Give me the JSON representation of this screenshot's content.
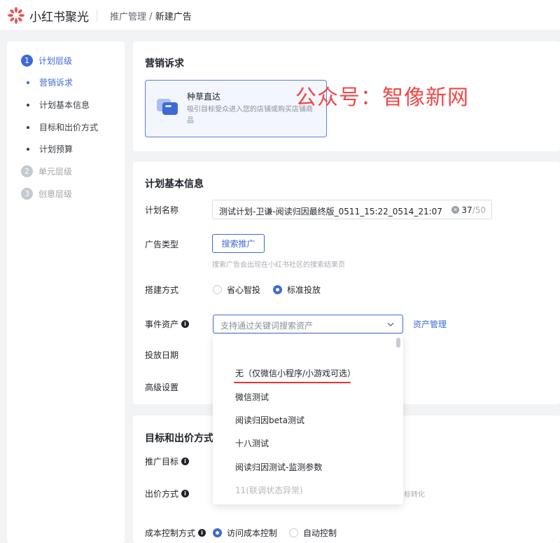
{
  "header": {
    "brand": "小红书聚光",
    "breadcrumb_parent": "推广管理",
    "breadcrumb_sep": "/",
    "breadcrumb_current": "新建广告"
  },
  "sidebar": {
    "steps": [
      {
        "num": "1",
        "label": "计划层级"
      },
      {
        "num": "2",
        "label": "单元层级"
      },
      {
        "num": "3",
        "label": "创意层级"
      }
    ],
    "sub_items": [
      "营销诉求",
      "计划基本信息",
      "目标和出价方式",
      "计划预算"
    ]
  },
  "marketing": {
    "title": "营销诉求",
    "option_title": "种草直达",
    "option_desc": "吸引目标受众进入您的店铺或购买店铺商品"
  },
  "watermark": "公众号：智像新网",
  "basic": {
    "title": "计划基本信息",
    "name_label": "计划名称",
    "name_value": "测试计划-卫谦-阅读归因最终版_0511_15:22_0514_21:07",
    "name_count": "37",
    "name_max": "/50",
    "type_label": "广告类型",
    "type_button": "搜索推广",
    "type_hint": "搜索广告会出现在小红书社区的搜索结果页",
    "build_label": "搭建方式",
    "build_options": [
      "省心智投",
      "标准投放"
    ],
    "event_label": "事件资产",
    "event_placeholder": "支持通过关键词搜索资产",
    "asset_link": "资产管理",
    "date_label": "投放日期",
    "advanced_label": "高级设置"
  },
  "dropdown": {
    "options": [
      "无（仅微信小程序/小游戏可选）",
      "微信测试",
      "阅读归因beta测试",
      "十八测试",
      "阅读归因测试-监测参数",
      "11(联调状态异常)"
    ]
  },
  "goal": {
    "title": "目标和出价方式",
    "target_label": "推广目标",
    "bid_label": "出价方式",
    "bid_side_text": "标转化",
    "cost_label": "成本控制方式",
    "cost_options": [
      "访问成本控制",
      "自动控制"
    ]
  },
  "colors": {
    "accent": "#3e6ad6",
    "watermark": "#f04848",
    "underline": "#e83434"
  }
}
